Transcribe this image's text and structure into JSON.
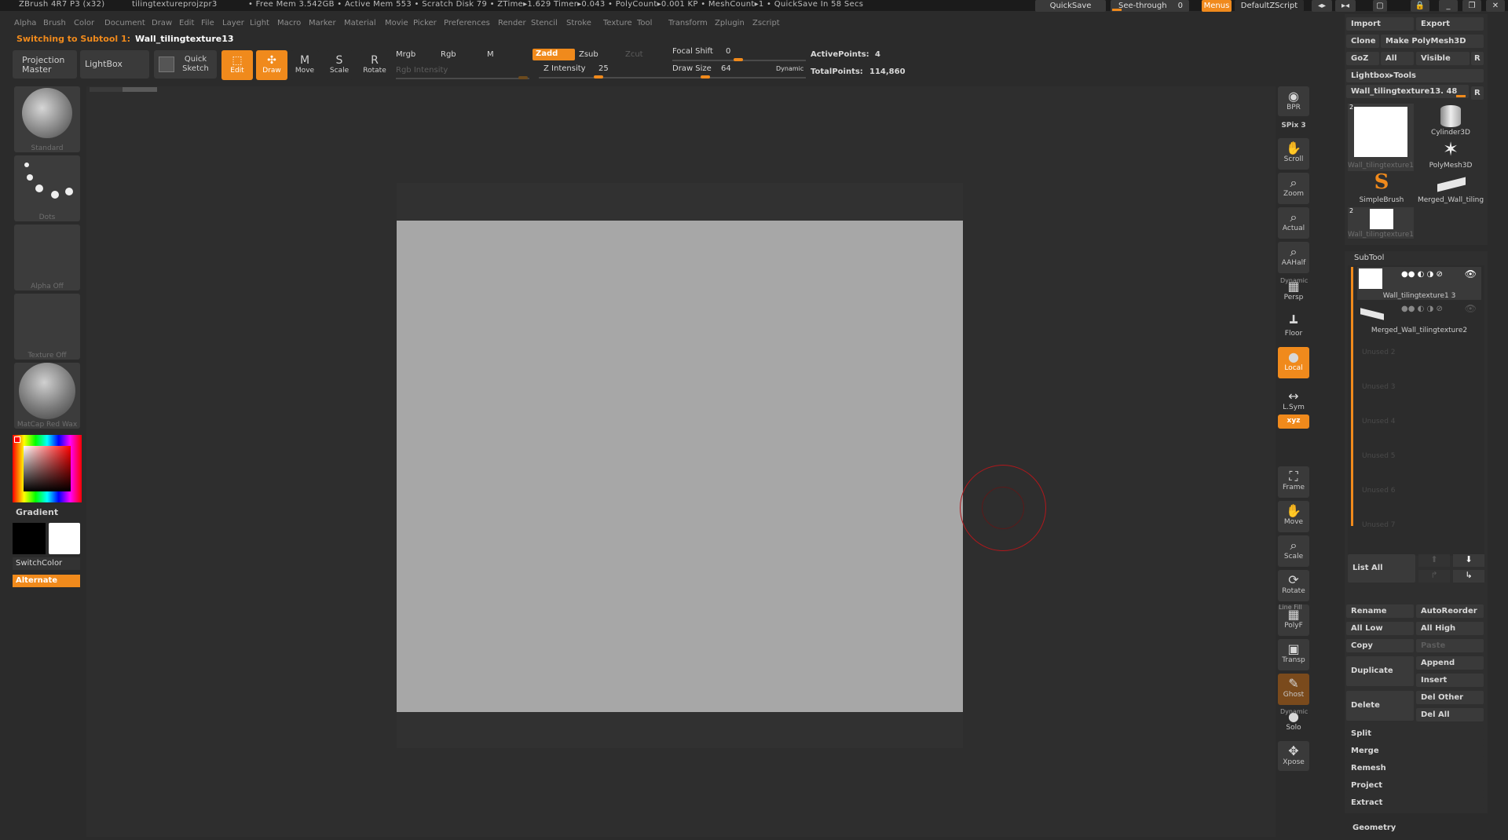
{
  "titlebar": {
    "app": "ZBrush 4R7 P3 (x32)",
    "document": "tilingtextureprojzpr3",
    "stats": "• Free Mem 3.542GB • Active Mem 553 • Scratch Disk 79 • ZTime▸1.629 Timer▸0.043 • PolyCount▸0.001 KP • MeshCount▸1 • QuickSave In 58 Secs",
    "quicksave": "QuickSave",
    "seethrough": "See-through",
    "seethrough_value": "0",
    "menus": "Menus",
    "defaultzscript": "DefaultZScript"
  },
  "menubar": [
    "Alpha",
    "Brush",
    "Color",
    "Document",
    "Draw",
    "Edit",
    "File",
    "Layer",
    "Light",
    "Macro",
    "Marker",
    "Material",
    "Movie",
    "Picker",
    "Preferences",
    "Render",
    "Stencil",
    "Stroke",
    "Texture",
    "Tool",
    "Transform",
    "Zplugin",
    "Zscript"
  ],
  "status": {
    "prefix": "Switching to Subtool 1:",
    "name": "Wall_tilingtexture13"
  },
  "toolbar": {
    "projection_master": "Projection Master",
    "lightbox": "LightBox",
    "quick_sketch": "Quick Sketch",
    "edit": "Edit",
    "draw": "Draw",
    "move": "Move",
    "scale": "Scale",
    "rotate": "Rotate",
    "mrgb": "Mrgb",
    "rgb": "Rgb",
    "m": "M",
    "zadd": "Zadd",
    "zsub": "Zsub",
    "zcut": "Zcut",
    "rgb_intensity": "Rgb Intensity",
    "z_intensity_label": "Z Intensity",
    "z_intensity_value": "25",
    "focal_shift_label": "Focal Shift",
    "focal_shift_value": "0",
    "draw_size_label": "Draw Size",
    "draw_size_value": "64",
    "dynamic": "Dynamic",
    "active_points_label": "ActivePoints:",
    "active_points_value": "4",
    "total_points_label": "TotalPoints:",
    "total_points_value": "114,860"
  },
  "left_shelf": {
    "brush": "Standard",
    "stroke": "Dots",
    "alpha": "Alpha Off",
    "texture": "Texture Off",
    "material": "MatCap Red Wax",
    "gradient": "Gradient",
    "switchcolor": "SwitchColor",
    "alternate": "Alternate"
  },
  "right_shelf": [
    {
      "name": "bpr",
      "label": "BPR",
      "icon": "◉"
    },
    {
      "name": "spix",
      "label": "SPix 3",
      "icon": ""
    },
    {
      "name": "scroll",
      "label": "Scroll",
      "icon": "✋"
    },
    {
      "name": "zoom",
      "label": "Zoom",
      "icon": "⌕"
    },
    {
      "name": "actual",
      "label": "Actual",
      "icon": "⌕"
    },
    {
      "name": "aahalf",
      "label": "AAHalf",
      "icon": "⌕"
    },
    {
      "name": "persp",
      "label": "Persp",
      "icon": "▦"
    },
    {
      "name": "floor",
      "label": "Floor",
      "icon": "┻"
    },
    {
      "name": "local",
      "label": "Local",
      "icon": "●"
    },
    {
      "name": "lsym",
      "label": "L.Sym",
      "icon": "↔"
    },
    {
      "name": "xyz",
      "label": "xyz",
      "icon": ""
    },
    {
      "name": "frame",
      "label": "Frame",
      "icon": "⛶"
    },
    {
      "name": "move",
      "label": "Move",
      "icon": "✋"
    },
    {
      "name": "scale",
      "label": "Scale",
      "icon": "⌕"
    },
    {
      "name": "rotate",
      "label": "Rotate",
      "icon": "⟳"
    },
    {
      "name": "polyf",
      "label": "PolyF",
      "icon": "▦"
    },
    {
      "name": "transp",
      "label": "Transp",
      "icon": "▣"
    },
    {
      "name": "ghost",
      "label": "Ghost",
      "icon": "✎"
    },
    {
      "name": "solo",
      "label": "Solo",
      "icon": "●"
    },
    {
      "name": "xpose",
      "label": "Xpose",
      "icon": "✥"
    }
  ],
  "right_shelf_extra": {
    "line_fill": "Line Fill",
    "dynamic": "Dynamic"
  },
  "tool_panel": {
    "import": "Import",
    "export": "Export",
    "clone": "Clone",
    "make_polymesh": "Make PolyMesh3D",
    "goz": "GoZ",
    "all": "All",
    "visible": "Visible",
    "r": "R",
    "lightbox_tools": "Lightbox▸Tools",
    "current_tool": "Wall_tilingtexture13. 48",
    "tools": [
      {
        "label": "Wall_tilingtexture1",
        "icon": "▢"
      },
      {
        "label": "Cylinder3D",
        "icon": "▮"
      },
      {
        "label": "PolyMesh3D",
        "icon": "✶"
      },
      {
        "label": "SimpleBrush",
        "icon": "S"
      },
      {
        "label": "Merged_Wall_tiling",
        "icon": "▬"
      },
      {
        "label": "Wall_tilingtexture1",
        "icon": "▢"
      }
    ],
    "thumb_counts": [
      "2",
      "2"
    ]
  },
  "subtool": {
    "title": "SubTool",
    "items": [
      {
        "label": "Wall_tilingtexture1 3"
      },
      {
        "label": "Merged_Wall_tilingtexture2"
      }
    ],
    "unused": [
      "Unused 2",
      "Unused 3",
      "Unused 4",
      "Unused 5",
      "Unused 6",
      "Unused 7"
    ],
    "list_all": "List All",
    "rename": "Rename",
    "autoreorder": "AutoReorder",
    "all_low": "All Low",
    "all_high": "All High",
    "copy": "Copy",
    "paste": "Paste",
    "duplicate": "Duplicate",
    "append": "Append",
    "insert": "Insert",
    "delete": "Delete",
    "del_other": "Del Other",
    "del_all": "Del All",
    "split": "Split",
    "merge": "Merge",
    "remesh": "Remesh",
    "project": "Project",
    "extract": "Extract",
    "geometry": "Geometry"
  },
  "colors": {
    "accent": "#f08a1c",
    "background": "#2b2b2b",
    "plane": "#a7a7a7",
    "cursor": "#b0181c"
  }
}
